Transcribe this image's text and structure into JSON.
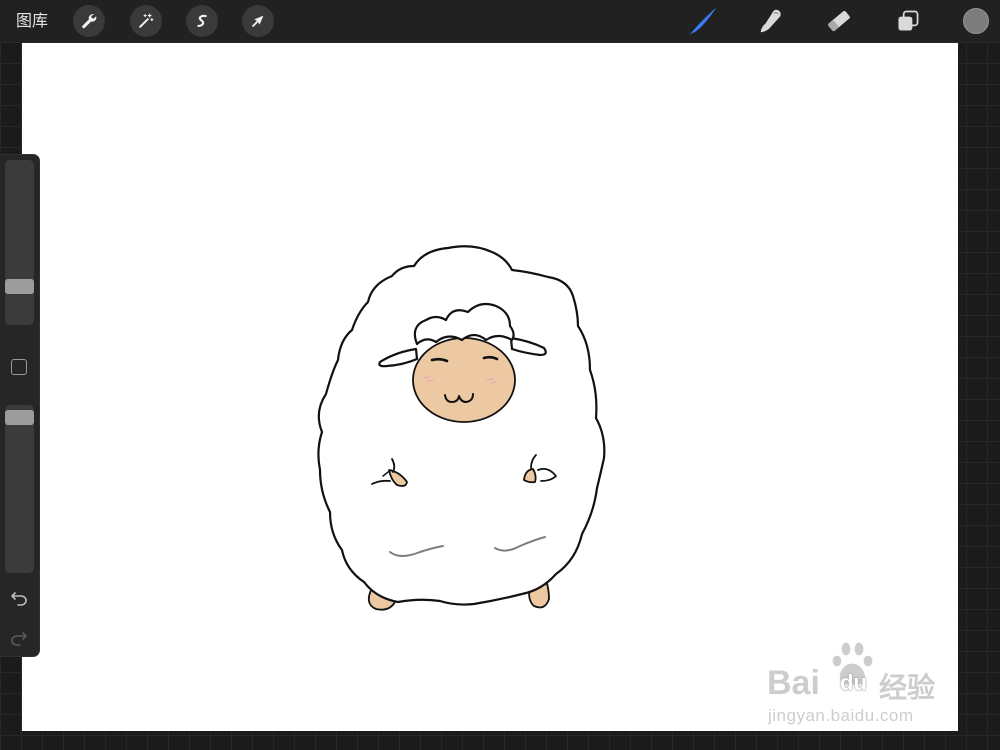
{
  "toolbar": {
    "gallery_label": "图库",
    "left_tools": [
      {
        "name": "actions",
        "icon": "wrench-icon"
      },
      {
        "name": "adjustments",
        "icon": "magic-wand-icon"
      },
      {
        "name": "selection",
        "icon": "selection-icon"
      },
      {
        "name": "transform",
        "icon": "transform-arrow-icon"
      }
    ],
    "right_tools": [
      {
        "name": "brush",
        "icon": "brush-icon",
        "active": true
      },
      {
        "name": "smudge",
        "icon": "smudge-icon",
        "active": false
      },
      {
        "name": "eraser",
        "icon": "eraser-icon",
        "active": false
      },
      {
        "name": "layers",
        "icon": "layers-icon",
        "active": false
      }
    ],
    "accent_color": "#3b7cf4",
    "current_color": "#7c7c7c"
  },
  "sidebar": {
    "brush_size_level": 0.21,
    "opacity_level": 0.97,
    "undo_icon": "undo-icon",
    "redo_icon": "redo-icon",
    "redo_available": false
  },
  "drawing": {
    "palette": {
      "outline": "#111111",
      "wool": "#ffffff",
      "skin": "#edc9a3",
      "blush": "#e8a7b4",
      "fold": "#7e7e7e"
    }
  },
  "watermark": {
    "brand_part_1": "Bai",
    "brand_part_2": "du",
    "brand_cn": "经验",
    "site": "jingyan.baidu.com"
  }
}
